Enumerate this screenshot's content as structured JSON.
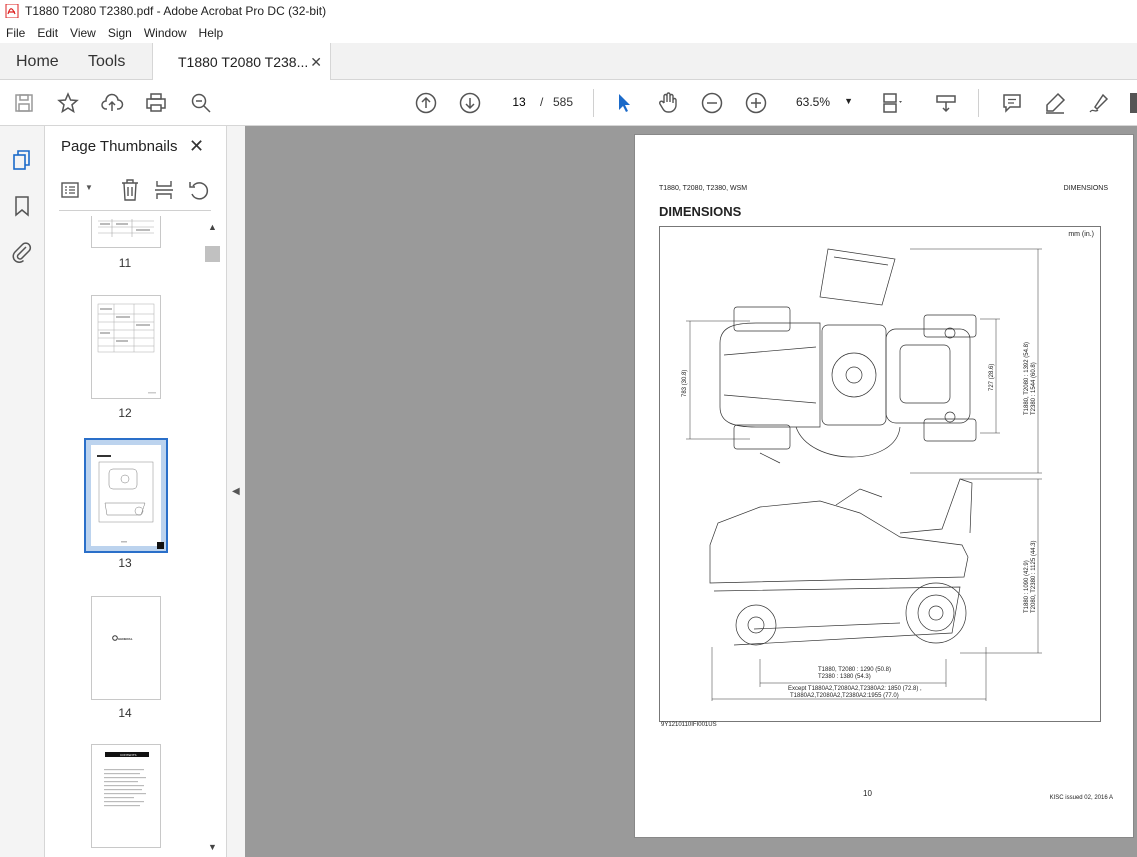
{
  "window": {
    "title": "T1880 T2080 T2380.pdf - Adobe Acrobat Pro DC (32-bit)"
  },
  "menu": [
    "File",
    "Edit",
    "View",
    "Sign",
    "Window",
    "Help"
  ],
  "tabs": {
    "home": "Home",
    "tools": "Tools",
    "document": "T1880 T2080 T238..."
  },
  "toolbar": {
    "current_page": "13",
    "separator": "/",
    "total_pages": "585",
    "zoom": "63.5%"
  },
  "thumbnails_panel": {
    "title": "Page Thumbnails",
    "pages": [
      {
        "label": "11"
      },
      {
        "label": "12"
      },
      {
        "label": "13",
        "selected": true
      },
      {
        "label": "14"
      },
      {
        "label": ""
      }
    ],
    "page14_text": "GENERAL",
    "page15_text": "CONTENTS"
  },
  "document": {
    "header_left": "T1880, T2080, T2380, WSM",
    "header_right": "DIMENSIONS",
    "title": "DIMENSIONS",
    "unit_note": "mm (in.)",
    "dims": {
      "d1": "783 (30.8)",
      "d2": "727 (28.6)",
      "d3a": "T1880, T2080 : 1392 (54.8)",
      "d3b": "T2380 : 1544 (60.8)",
      "d4a": "T1880 : 1090 (42.9)",
      "d4b": "T2080, T2380 : 1125 (44.3)",
      "d5a": "T1880, T2080 : 1290 (50.8)",
      "d5b": "T2380 : 1380 (54.3)",
      "d6a": "Except T1880A2,T2080A2,T2380A2: 1850 (72.8) ,",
      "d6b": "T1880A2,T2080A2,T2380A2:1955 (77.0)"
    },
    "figure_id": "9Y1210110IFI001US",
    "page_number": "10",
    "issue": "KISC issued 02, 2016 A"
  }
}
